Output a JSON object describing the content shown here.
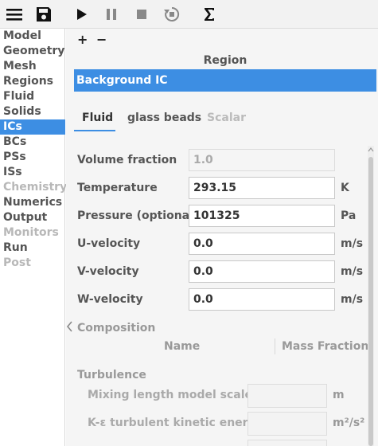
{
  "toolbar": {
    "icons": [
      "menu-icon",
      "save-icon",
      "play-icon",
      "pause-icon",
      "stop-icon",
      "reset-icon",
      "sigma-icon"
    ]
  },
  "sidebar": {
    "items": [
      {
        "label": "Model",
        "state": "normal"
      },
      {
        "label": "Geometry",
        "state": "normal"
      },
      {
        "label": "Mesh",
        "state": "normal"
      },
      {
        "label": "Regions",
        "state": "normal"
      },
      {
        "label": "Fluid",
        "state": "normal"
      },
      {
        "label": "Solids",
        "state": "normal"
      },
      {
        "label": "ICs",
        "state": "selected"
      },
      {
        "label": "BCs",
        "state": "normal"
      },
      {
        "label": "PSs",
        "state": "normal"
      },
      {
        "label": "ISs",
        "state": "normal"
      },
      {
        "label": "Chemistry",
        "state": "disabled"
      },
      {
        "label": "Numerics",
        "state": "normal"
      },
      {
        "label": "Output",
        "state": "normal"
      },
      {
        "label": "Monitors",
        "state": "disabled"
      },
      {
        "label": "Run",
        "state": "normal"
      },
      {
        "label": "Post",
        "state": "disabled"
      }
    ]
  },
  "region_table": {
    "add_label": "+",
    "remove_label": "−",
    "header": "Region",
    "rows": [
      "Background IC"
    ]
  },
  "tabs": [
    {
      "label": "Fluid",
      "state": "active"
    },
    {
      "label": "glass beads",
      "state": "normal"
    },
    {
      "label": "Scalar",
      "state": "disabled"
    }
  ],
  "fields": {
    "volume_fraction": {
      "label": "Volume fraction",
      "value": "1.0",
      "unit": ""
    },
    "temperature": {
      "label": "Temperature",
      "value": "293.15",
      "unit": "K"
    },
    "pressure": {
      "label": "Pressure (optional)",
      "value": "101325",
      "unit": "Pa"
    },
    "u_velocity": {
      "label": "U-velocity",
      "value": "0.0",
      "unit": "m/s"
    },
    "v_velocity": {
      "label": "V-velocity",
      "value": "0.0",
      "unit": "m/s"
    },
    "w_velocity": {
      "label": "W-velocity",
      "value": "0.0",
      "unit": "m/s"
    }
  },
  "composition": {
    "title": "Composition",
    "col_name": "Name",
    "col_mass_fraction": "Mass Fraction"
  },
  "turbulence": {
    "title": "Turbulence",
    "mixing_length": {
      "label": "Mixing length model scale",
      "unit": "m"
    },
    "ke_energy": {
      "label": "K-ε turbulent kinetic energy",
      "unit": "m²/s²"
    }
  },
  "colors": {
    "accent": "#3d8ee3",
    "panel_bg": "#f5f5f5",
    "toolbar_bg": "#f2f2f2"
  }
}
